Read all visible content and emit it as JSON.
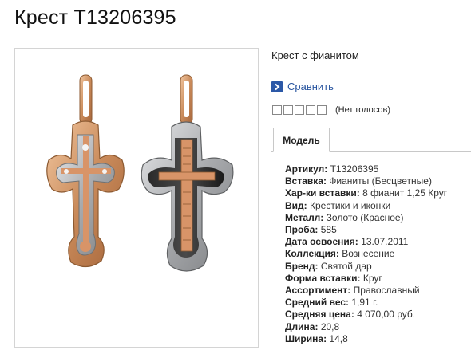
{
  "page_title": "Крест Т13206395",
  "product": {
    "subtitle": "Крест с фианитом",
    "compare_label": "Сравнить",
    "rating": {
      "stars": 5,
      "filled": 0,
      "votes_text": "(Нет голосов)"
    },
    "tab_label": "Модель",
    "specs": [
      {
        "label": "Артикул:",
        "value": "Т13206395"
      },
      {
        "label": "Вставка:",
        "value": "Фианиты (Бесцветные)"
      },
      {
        "label": "Хар-ки вставки:",
        "value": "8 фианит 1,25 Круг"
      },
      {
        "label": "Вид:",
        "value": "Крестики и иконки"
      },
      {
        "label": "Металл:",
        "value": "Золото (Красное)"
      },
      {
        "label": "Проба:",
        "value": "585"
      },
      {
        "label": "Дата освоения:",
        "value": "13.07.2011"
      },
      {
        "label": "Коллекция:",
        "value": "Вознесение"
      },
      {
        "label": "Бренд:",
        "value": "Святой дар"
      },
      {
        "label": "Форма вставки:",
        "value": "Круг"
      },
      {
        "label": "Ассортимент:",
        "value": "Православный"
      },
      {
        "label": "Средний вес:",
        "value": "1,91 г."
      },
      {
        "label": "Средняя цена:",
        "value": "4 070,00 руб."
      },
      {
        "label": "Длина:",
        "value": "20,8"
      },
      {
        "label": "Ширина:",
        "value": "14,8"
      }
    ]
  },
  "colors": {
    "gold": "#c98a5a",
    "silver": "#b9bbbd",
    "link": "#2a56a0",
    "icon_bg": "#2b58a7"
  },
  "icons": [
    "compare-arrow-icon"
  ]
}
